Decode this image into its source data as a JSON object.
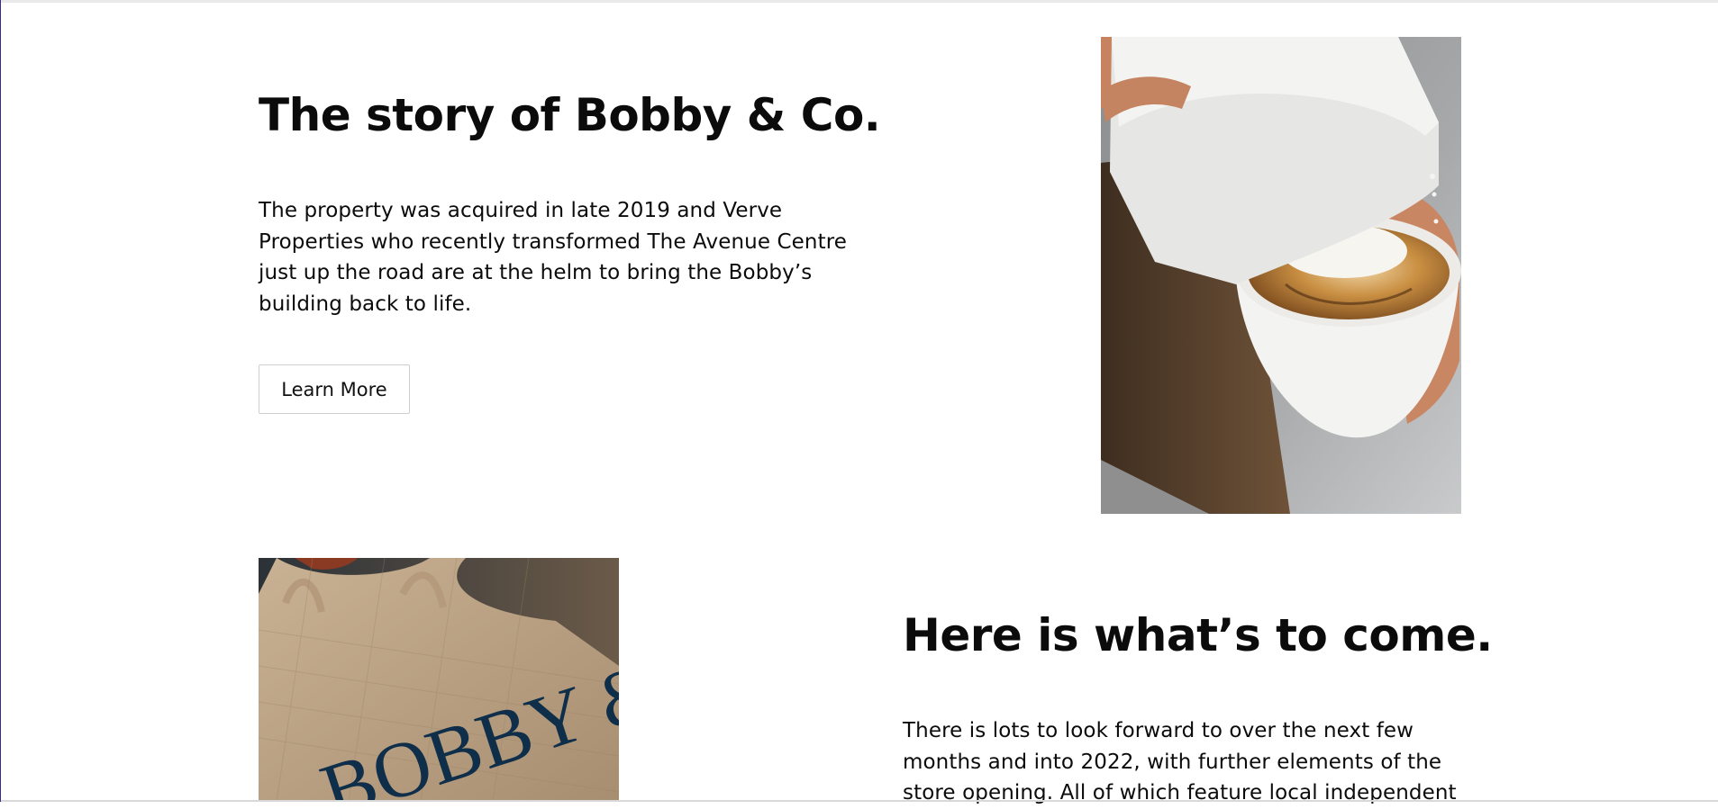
{
  "story": {
    "title": "The story of Bobby & Co.",
    "body": "The property was acquired in late 2019 and Verve Properties who recently transformed The Avenue Centre just up the road are at the helm to bring the Bobby’s building back to life.",
    "button_label": "Learn More",
    "image_icon": "latte-art-photo"
  },
  "coming": {
    "title": "Here is what’s to come.",
    "body": "There is lots to look forward to over the next few months and into 2022, with further elements of the store opening. All of which feature local independent",
    "image_icon": "tote-bag-photo",
    "bag_print": "BOBBY & CO"
  },
  "colors": {
    "text": "#0b0b0b",
    "button_border": "#cfcfcf",
    "background": "#ffffff"
  }
}
